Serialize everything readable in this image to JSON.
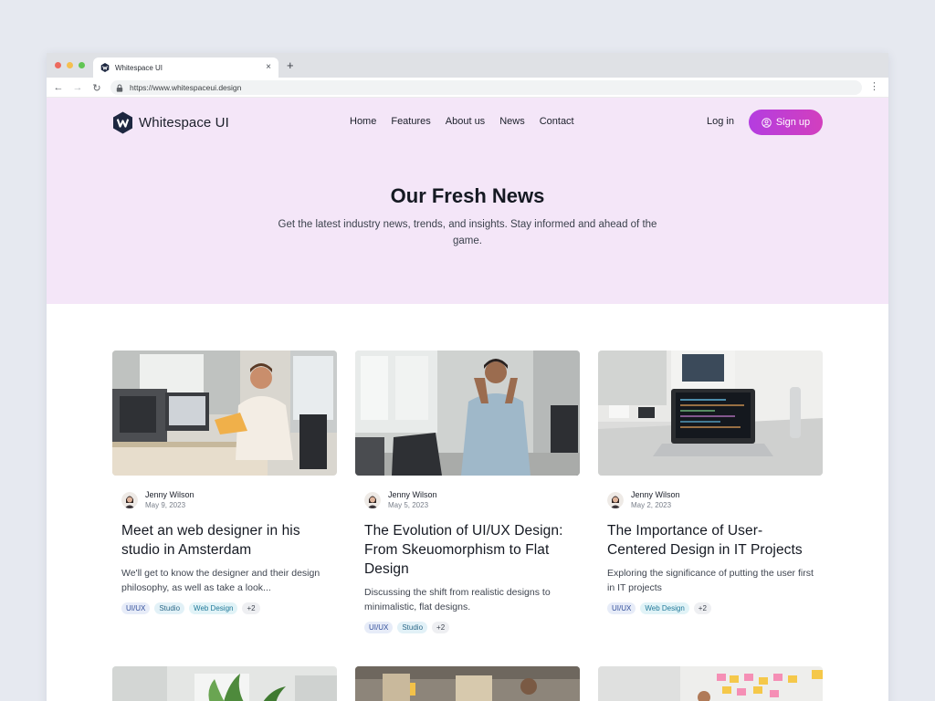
{
  "browser": {
    "tab_title": "Whitespace UI",
    "close_glyph": "×",
    "newtab_glyph": "+",
    "url": "https://www.whitespaceui.design",
    "back_glyph": "←",
    "forward_glyph": "→",
    "reload_glyph": "↻",
    "menu_glyph": "⋮",
    "traffic_colors": [
      "#ed6a5e",
      "#f5bf4f",
      "#61c554"
    ]
  },
  "site": {
    "brand": "Whitespace UI",
    "nav": [
      "Home",
      "Features",
      "About us",
      "News",
      "Contact"
    ],
    "login": "Log in",
    "signup": "Sign up",
    "accent": "#c03dd5",
    "hero_bg": "#f4e6f8"
  },
  "hero": {
    "title": "Our Fresh News",
    "subtitle": "Get the latest industry news, trends, and insights. Stay informed and ahead of the game."
  },
  "cards": [
    {
      "author": "Jenny Wilson",
      "date": "May 9, 2023",
      "title": "Meet an web designer in his studio in Amsterdam",
      "excerpt": "We'll get to know the designer and their design philosophy, as well as take a look...",
      "tags": [
        "UI/UX",
        "Studio",
        "Web Design"
      ],
      "more": "+2"
    },
    {
      "author": "Jenny Wilson",
      "date": "May 5, 2023",
      "title": "The Evolution of UI/UX Design: From Skeuomorphism to Flat Design",
      "excerpt": "Discussing the shift from realistic designs to minimalistic, flat designs.",
      "tags": [
        "UI/UX",
        "Studio"
      ],
      "more": "+2"
    },
    {
      "author": "Jenny Wilson",
      "date": "May 2, 2023",
      "title": "The Importance of User-Centered Design in IT Projects",
      "excerpt": "Exploring the significance of putting the user first in IT projects",
      "tags": [
        "UI/UX",
        "Web Design"
      ],
      "more": "+2"
    }
  ]
}
